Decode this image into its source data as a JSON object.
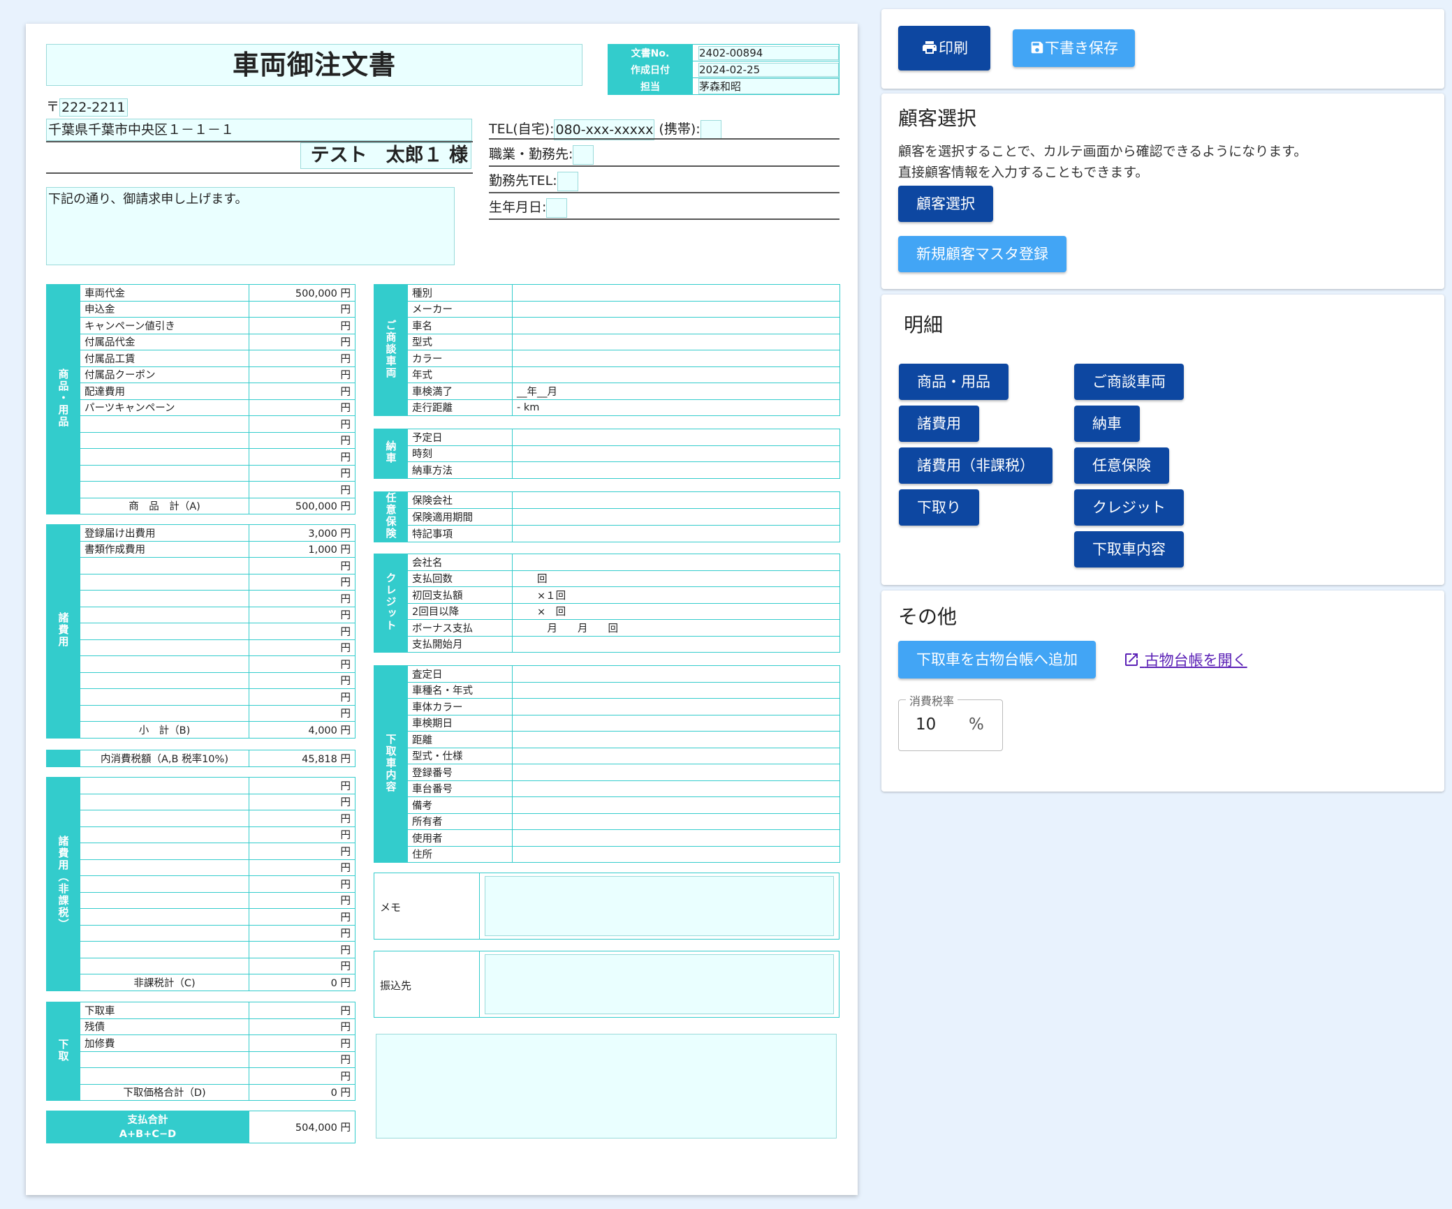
{
  "doc": {
    "title": "車両御注文書",
    "info": [
      {
        "label": "文書No.",
        "value": "2402-00894"
      },
      {
        "label": "作成日付",
        "value": "2024-02-25"
      },
      {
        "label": "担当",
        "value": "茅森和昭"
      }
    ],
    "postal_mark": "〒",
    "postal": "222-2211",
    "address": "千葉県千葉市中央区１－１－１",
    "customer_name": "テスト　太郎１ 様",
    "tel_home_label": "TEL(自宅):",
    "tel_home": "080-xxx-xxxxx",
    "tel_mobile_label": "(携帯):",
    "job_label": "職業・勤務先:",
    "work_tel_label": "勤務先TEL:",
    "birth_label": "生年月日:",
    "note": "下記の通り、御請求申し上げます。"
  },
  "yen": "円",
  "goods": {
    "side": "商品・用品",
    "rows": [
      {
        "label": "車両代金",
        "amount": "500,000"
      },
      {
        "label": "申込金",
        "amount": ""
      },
      {
        "label": "キャンペーン値引き",
        "amount": ""
      },
      {
        "label": "付属品代金",
        "amount": ""
      },
      {
        "label": "付属品工賃",
        "amount": ""
      },
      {
        "label": "付属品クーポン",
        "amount": ""
      },
      {
        "label": "配達費用",
        "amount": ""
      },
      {
        "label": "パーツキャンペーン",
        "amount": ""
      },
      {
        "label": "",
        "amount": ""
      },
      {
        "label": "",
        "amount": ""
      },
      {
        "label": "",
        "amount": ""
      },
      {
        "label": "",
        "amount": ""
      },
      {
        "label": "",
        "amount": ""
      }
    ],
    "total_label": "商　品　計（A)",
    "total": "500,000"
  },
  "fees": {
    "side": "諸費用",
    "rows": [
      {
        "label": "登録届け出費用",
        "amount": "3,000"
      },
      {
        "label": "書類作成費用",
        "amount": "1,000"
      },
      {
        "label": "",
        "amount": ""
      },
      {
        "label": "",
        "amount": ""
      },
      {
        "label": "",
        "amount": ""
      },
      {
        "label": "",
        "amount": ""
      },
      {
        "label": "",
        "amount": ""
      },
      {
        "label": "",
        "amount": ""
      },
      {
        "label": "",
        "amount": ""
      },
      {
        "label": "",
        "amount": ""
      },
      {
        "label": "",
        "amount": ""
      },
      {
        "label": "",
        "amount": ""
      }
    ],
    "total_label": "小　計（B)",
    "total": "4,000"
  },
  "tax": {
    "label": "内消費税額（A,B 税率10%)",
    "amount": "45,818"
  },
  "nontax": {
    "side": "諸費用（非課税）",
    "rows_count": 12,
    "total_label": "非課税計（C)",
    "total": "0"
  },
  "tradein": {
    "side": "下取",
    "rows": [
      {
        "label": "下取車",
        "amount": ""
      },
      {
        "label": "残債",
        "amount": ""
      },
      {
        "label": "加修費",
        "amount": ""
      },
      {
        "label": "",
        "amount": ""
      },
      {
        "label": "",
        "amount": ""
      }
    ],
    "total_label": "下取価格合計（D)",
    "total": "0"
  },
  "grand": {
    "label1": "支払合計",
    "label2": "A+B+C−D",
    "amount": "504,000"
  },
  "vehicle": {
    "side": "ご商談車両",
    "rows": [
      {
        "label": "種別",
        "value": ""
      },
      {
        "label": "メーカー",
        "value": ""
      },
      {
        "label": "車名",
        "value": ""
      },
      {
        "label": "型式",
        "value": ""
      },
      {
        "label": "カラー",
        "value": ""
      },
      {
        "label": "年式",
        "value": ""
      },
      {
        "label": "車検満了",
        "value": "__年__月"
      },
      {
        "label": "走行距離",
        "value": "- km"
      }
    ]
  },
  "delivery": {
    "side": "納車",
    "rows": [
      {
        "label": "予定日",
        "value": ""
      },
      {
        "label": "時刻",
        "value": ""
      },
      {
        "label": "納車方法",
        "value": ""
      }
    ]
  },
  "insurance": {
    "side": "任意保険",
    "rows": [
      {
        "label": "保険会社",
        "value": ""
      },
      {
        "label": "保険適用期間",
        "value": ""
      },
      {
        "label": "特記事項",
        "value": ""
      }
    ]
  },
  "credit": {
    "side": "クレジット",
    "rows": [
      {
        "label": "会社名",
        "value": ""
      },
      {
        "label": "支払回数",
        "value": "　　回"
      },
      {
        "label": "初回支払額",
        "value": "　　×１回"
      },
      {
        "label": "2回目以降",
        "value": "　　×　回"
      },
      {
        "label": "ボーナス支払",
        "value": "　　　月　　月　　回"
      },
      {
        "label": "支払開始月",
        "value": ""
      }
    ]
  },
  "tradein_detail": {
    "side": "下取車内容",
    "rows": [
      {
        "label": "査定日",
        "value": ""
      },
      {
        "label": "車種名・年式",
        "value": ""
      },
      {
        "label": "車体カラー",
        "value": ""
      },
      {
        "label": "車検期日",
        "value": ""
      },
      {
        "label": "距離",
        "value": ""
      },
      {
        "label": "型式・仕様",
        "value": ""
      },
      {
        "label": "登録番号",
        "value": ""
      },
      {
        "label": "車台番号",
        "value": ""
      },
      {
        "label": "備考",
        "value": ""
      },
      {
        "label": "所有者",
        "value": ""
      },
      {
        "label": "使用者",
        "value": ""
      },
      {
        "label": "住所",
        "value": ""
      }
    ]
  },
  "memo_label": "メモ",
  "bank_label": "振込先",
  "panel": {
    "print_label": "印刷",
    "draft_label": "下書き保存",
    "customer_title": "顧客選択",
    "customer_desc1": "顧客を選択することで、カルテ画面から確認できるようになります。",
    "customer_desc2": "直接顧客情報を入力することもできます。",
    "customer_select_btn": "顧客選択",
    "new_customer_btn": "新規顧客マスタ登録",
    "detail_title": "明細",
    "detail_buttons_left": [
      "商品・用品",
      "諸費用",
      "諸費用（非課税）",
      "下取り"
    ],
    "detail_buttons_right": [
      "ご商談車両",
      "納車",
      "任意保険",
      "クレジット",
      "下取車内容"
    ],
    "other_title": "その他",
    "add_ledger_btn": "下取車を古物台帳へ追加",
    "open_ledger_link": "古物台帳を開く",
    "tax_rate_label": "消費税率",
    "tax_rate_value": "10",
    "tax_rate_unit": "%"
  },
  "colors": {
    "accent": "#33cccc",
    "light_fill": "#eaffff",
    "primary": "#0d47a1",
    "secondary": "#42a5f5",
    "background": "#e8f2fd"
  }
}
